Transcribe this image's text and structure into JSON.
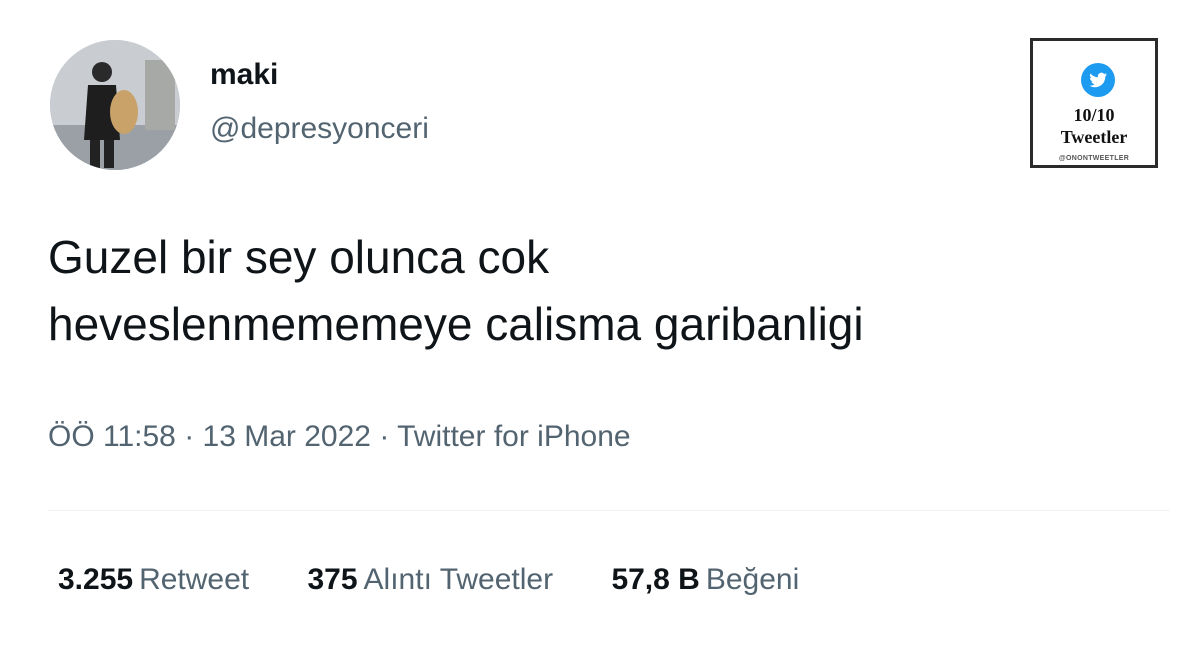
{
  "user": {
    "display_name": "maki",
    "handle": "@depresyonceri"
  },
  "tweet": {
    "lines": [
      "Guzel bir sey olunca cok",
      "heveslenmememeye calisma garibanligi"
    ],
    "time": "ÖÖ 11:58",
    "date": "13 Mar 2022",
    "source": "Twitter for iPhone",
    "separator": "·"
  },
  "stats": [
    {
      "count": "3.255",
      "label": "Retweet"
    },
    {
      "count": "375",
      "label": "Alıntı Tweetler"
    },
    {
      "count": "57,8 B",
      "label": "Beğeni"
    }
  ],
  "badge": {
    "score": "10/10",
    "title": "Tweetler",
    "handle": "@ONONTWEETLER",
    "icon": "twitter-bird-icon"
  },
  "colors": {
    "text": "#0f1419",
    "muted": "#536471",
    "twitter_blue": "#1d9bf0",
    "divider": "#eff3f4"
  }
}
